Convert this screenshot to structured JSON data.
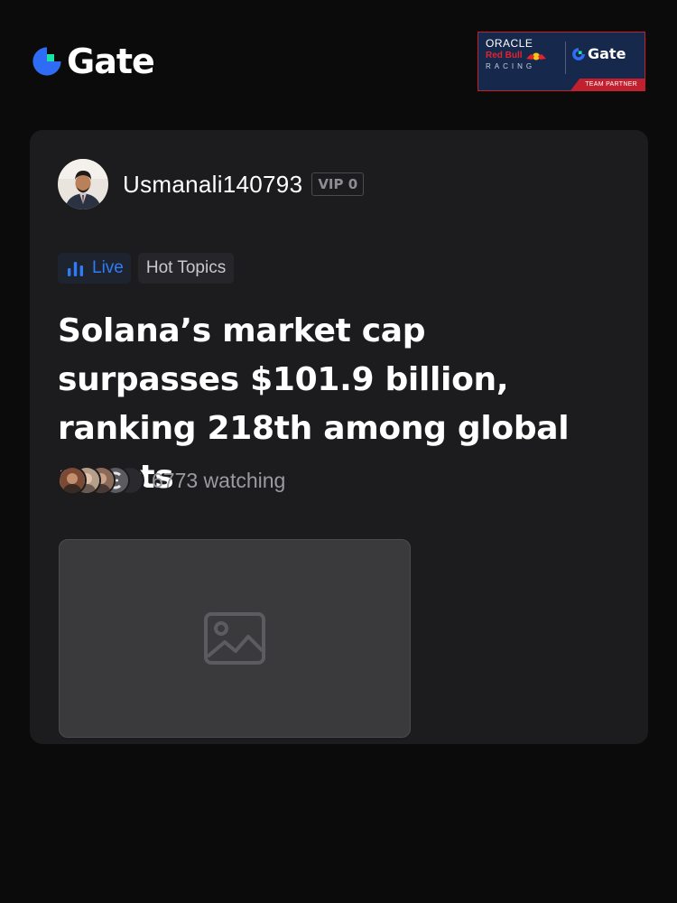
{
  "brand": {
    "logo_text": "Gate",
    "logo_icon": "gate-logo-icon",
    "accent_color": "#2f7cf6",
    "logo_green": "#17e5a3"
  },
  "partner_banner": {
    "line1": "ORACLE",
    "line2": "Red Bull",
    "line3": "RACING",
    "gate_text": "Gate",
    "ribbon": "TEAM PARTNER"
  },
  "post": {
    "author": {
      "name": "Usmanali140793",
      "vip_label": "VIP 0"
    },
    "tags": [
      {
        "label": "Live",
        "icon": "bar-chart-icon"
      },
      {
        "label": "Hot Topics"
      }
    ],
    "headline": "Solana’s market cap surpasses $101.9 billion, ranking 218th among global assets",
    "watching_text": "6773 watching",
    "image_icon": "image-placeholder-icon"
  }
}
